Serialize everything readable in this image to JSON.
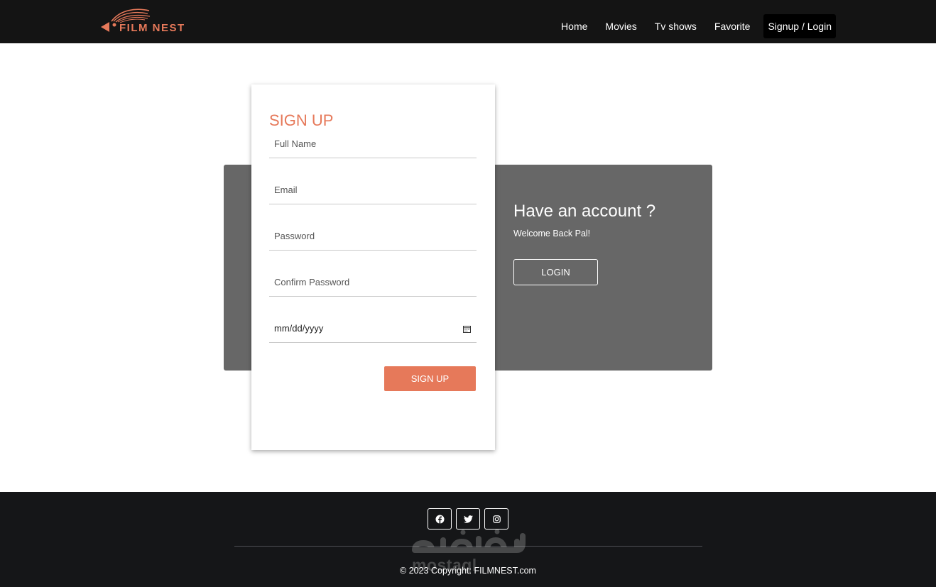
{
  "brand": {
    "logo_text": "FILM NEST",
    "accent_color": "#e6795a"
  },
  "nav": {
    "items": [
      {
        "label": "Home"
      },
      {
        "label": "Movies"
      },
      {
        "label": "Tv shows"
      },
      {
        "label": "Favorite"
      },
      {
        "label": "Signup / Login",
        "active": true
      }
    ]
  },
  "signup_form": {
    "title": "SIGN UP",
    "fields": {
      "full_name": {
        "placeholder": "Full Name"
      },
      "email": {
        "placeholder": "Email"
      },
      "password": {
        "placeholder": "Password"
      },
      "confirm_password": {
        "placeholder": "Confirm Password"
      },
      "birth_date": {
        "placeholder": "mm/dd/yyyy",
        "icon": "calendar-icon"
      }
    },
    "submit_label": "SIGN UP"
  },
  "login_panel": {
    "heading": "Have an account ?",
    "subtext": "Welcome Back Pal!",
    "button_label": "LOGIN",
    "background": "#676767"
  },
  "footer": {
    "social_icons": [
      "facebook-icon",
      "twitter-icon",
      "instagram-icon"
    ],
    "copyright": "© 2023 Copyright: FILMNEST.com",
    "watermark_text": "mostaql"
  }
}
